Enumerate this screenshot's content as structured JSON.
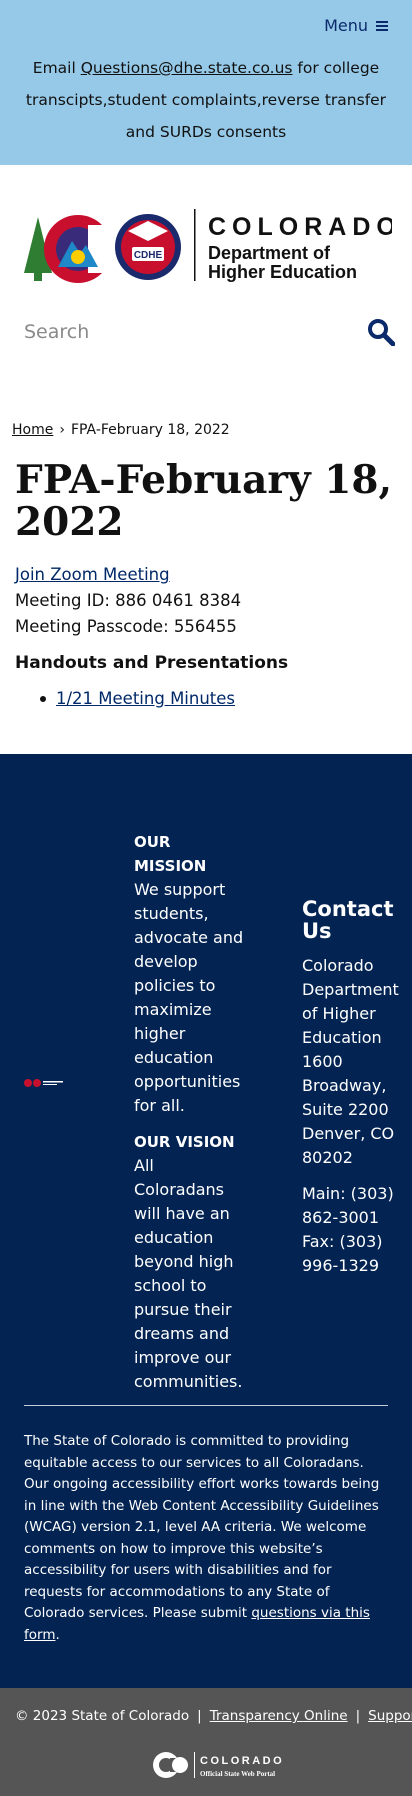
{
  "top_banner": {
    "menu_label": "Menu",
    "notice_prefix": "Email ",
    "notice_email": "Questions@dhe.state.co.us",
    "notice_suffix": " for college transcipts,student complaints,reverse transfer and SURDs consents"
  },
  "header": {
    "logo_title": "COLORADO",
    "logo_subtitle_line1": "Department of",
    "logo_subtitle_line2": "Higher Education",
    "logo_badge": "CDHE",
    "search_placeholder": "Search"
  },
  "breadcrumb": {
    "home": "Home",
    "separator": "›",
    "current": "FPA-February 18, 2022"
  },
  "main": {
    "title": "FPA-February 18, 2022",
    "zoom_link": "Join Zoom Meeting",
    "meeting_id": "Meeting ID: 886 0461 8384",
    "meeting_passcode": "Meeting Passcode: 556455",
    "handouts_heading": "Handouts and Presentations",
    "handouts": [
      "1/21 Meeting Minutes"
    ]
  },
  "footer": {
    "mission_heading": "OUR MISSION",
    "mission_text": "We support students, advocate and develop policies to maximize higher education opportunities for all.",
    "vision_heading": "OUR VISION",
    "vision_text": "All Coloradans will have an education beyond high school to pursue their dreams and improve our communities.",
    "contact_heading": "Contact Us",
    "contact_address": "Colorado Department of Higher Education 1600 Broadway, Suite 2200 Denver, CO 80202",
    "contact_main": "Main: (303) 862-3001",
    "contact_fax": "Fax: (303) 996-1329",
    "accessibility_text": "The State of Colorado is committed to providing equitable access to our services to all Coloradans. Our ongoing accessibility effort works towards being in line with the Web Content Accessibility Guidelines (WCAG) version 2.1, level AA criteria. We welcome comments on how to improve this website’s accessibility for users with disabilities and for requests for accommodations to any State of Colorado services. Please submit ",
    "accessibility_link": "questions via this form",
    "accessibility_end": "."
  },
  "bottom_bar": {
    "copyright": "© 2023 State of Colorado",
    "separator": "|",
    "transparency": "Transparency Online",
    "support": "Support",
    "state_logo_title": "COLORADO",
    "state_logo_subtitle": "Official State Web Portal"
  },
  "colors": {
    "banner": "#96c9e8",
    "navy": "#032453",
    "link": "#002868",
    "bottom_bar": "#555555"
  }
}
